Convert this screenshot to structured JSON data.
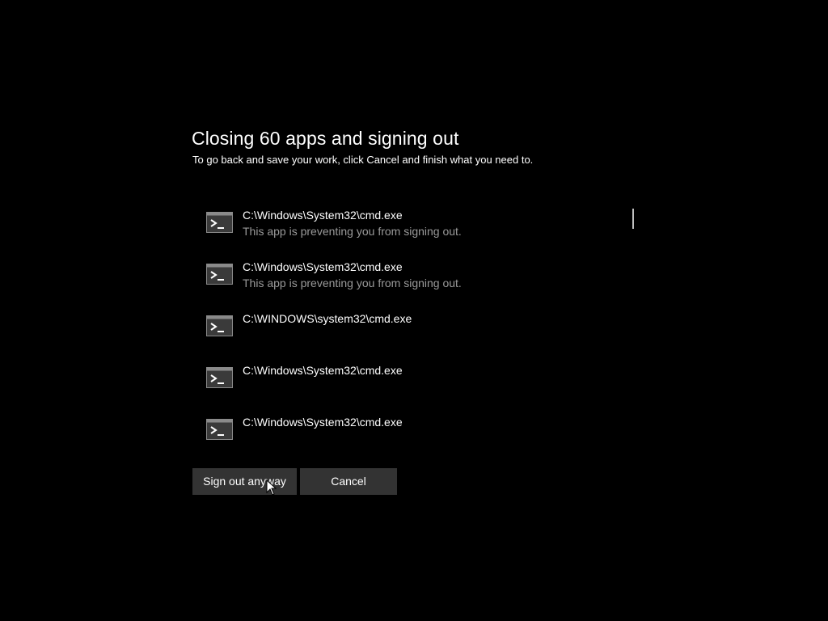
{
  "dialog": {
    "title": "Closing 60 apps and signing out",
    "subtitle": "To go back and save your work, click Cancel and finish what you need to."
  },
  "apps": [
    {
      "name": "C:\\Windows\\System32\\cmd.exe",
      "status": "This app is preventing you from signing out.",
      "icon": "command-prompt-icon"
    },
    {
      "name": "C:\\Windows\\System32\\cmd.exe",
      "status": "This app is preventing you from signing out.",
      "icon": "command-prompt-icon"
    },
    {
      "name": "C:\\WINDOWS\\system32\\cmd.exe",
      "status": "",
      "icon": "command-prompt-icon"
    },
    {
      "name": "C:\\Windows\\System32\\cmd.exe",
      "status": "",
      "icon": "command-prompt-icon"
    },
    {
      "name": "C:\\Windows\\System32\\cmd.exe",
      "status": "",
      "icon": "command-prompt-icon"
    }
  ],
  "buttons": {
    "sign_out_label": "Sign out anyway",
    "cancel_label": "Cancel"
  },
  "colors": {
    "background": "#000000",
    "button_bg": "#333333",
    "secondary_text": "#9a9a9a"
  }
}
